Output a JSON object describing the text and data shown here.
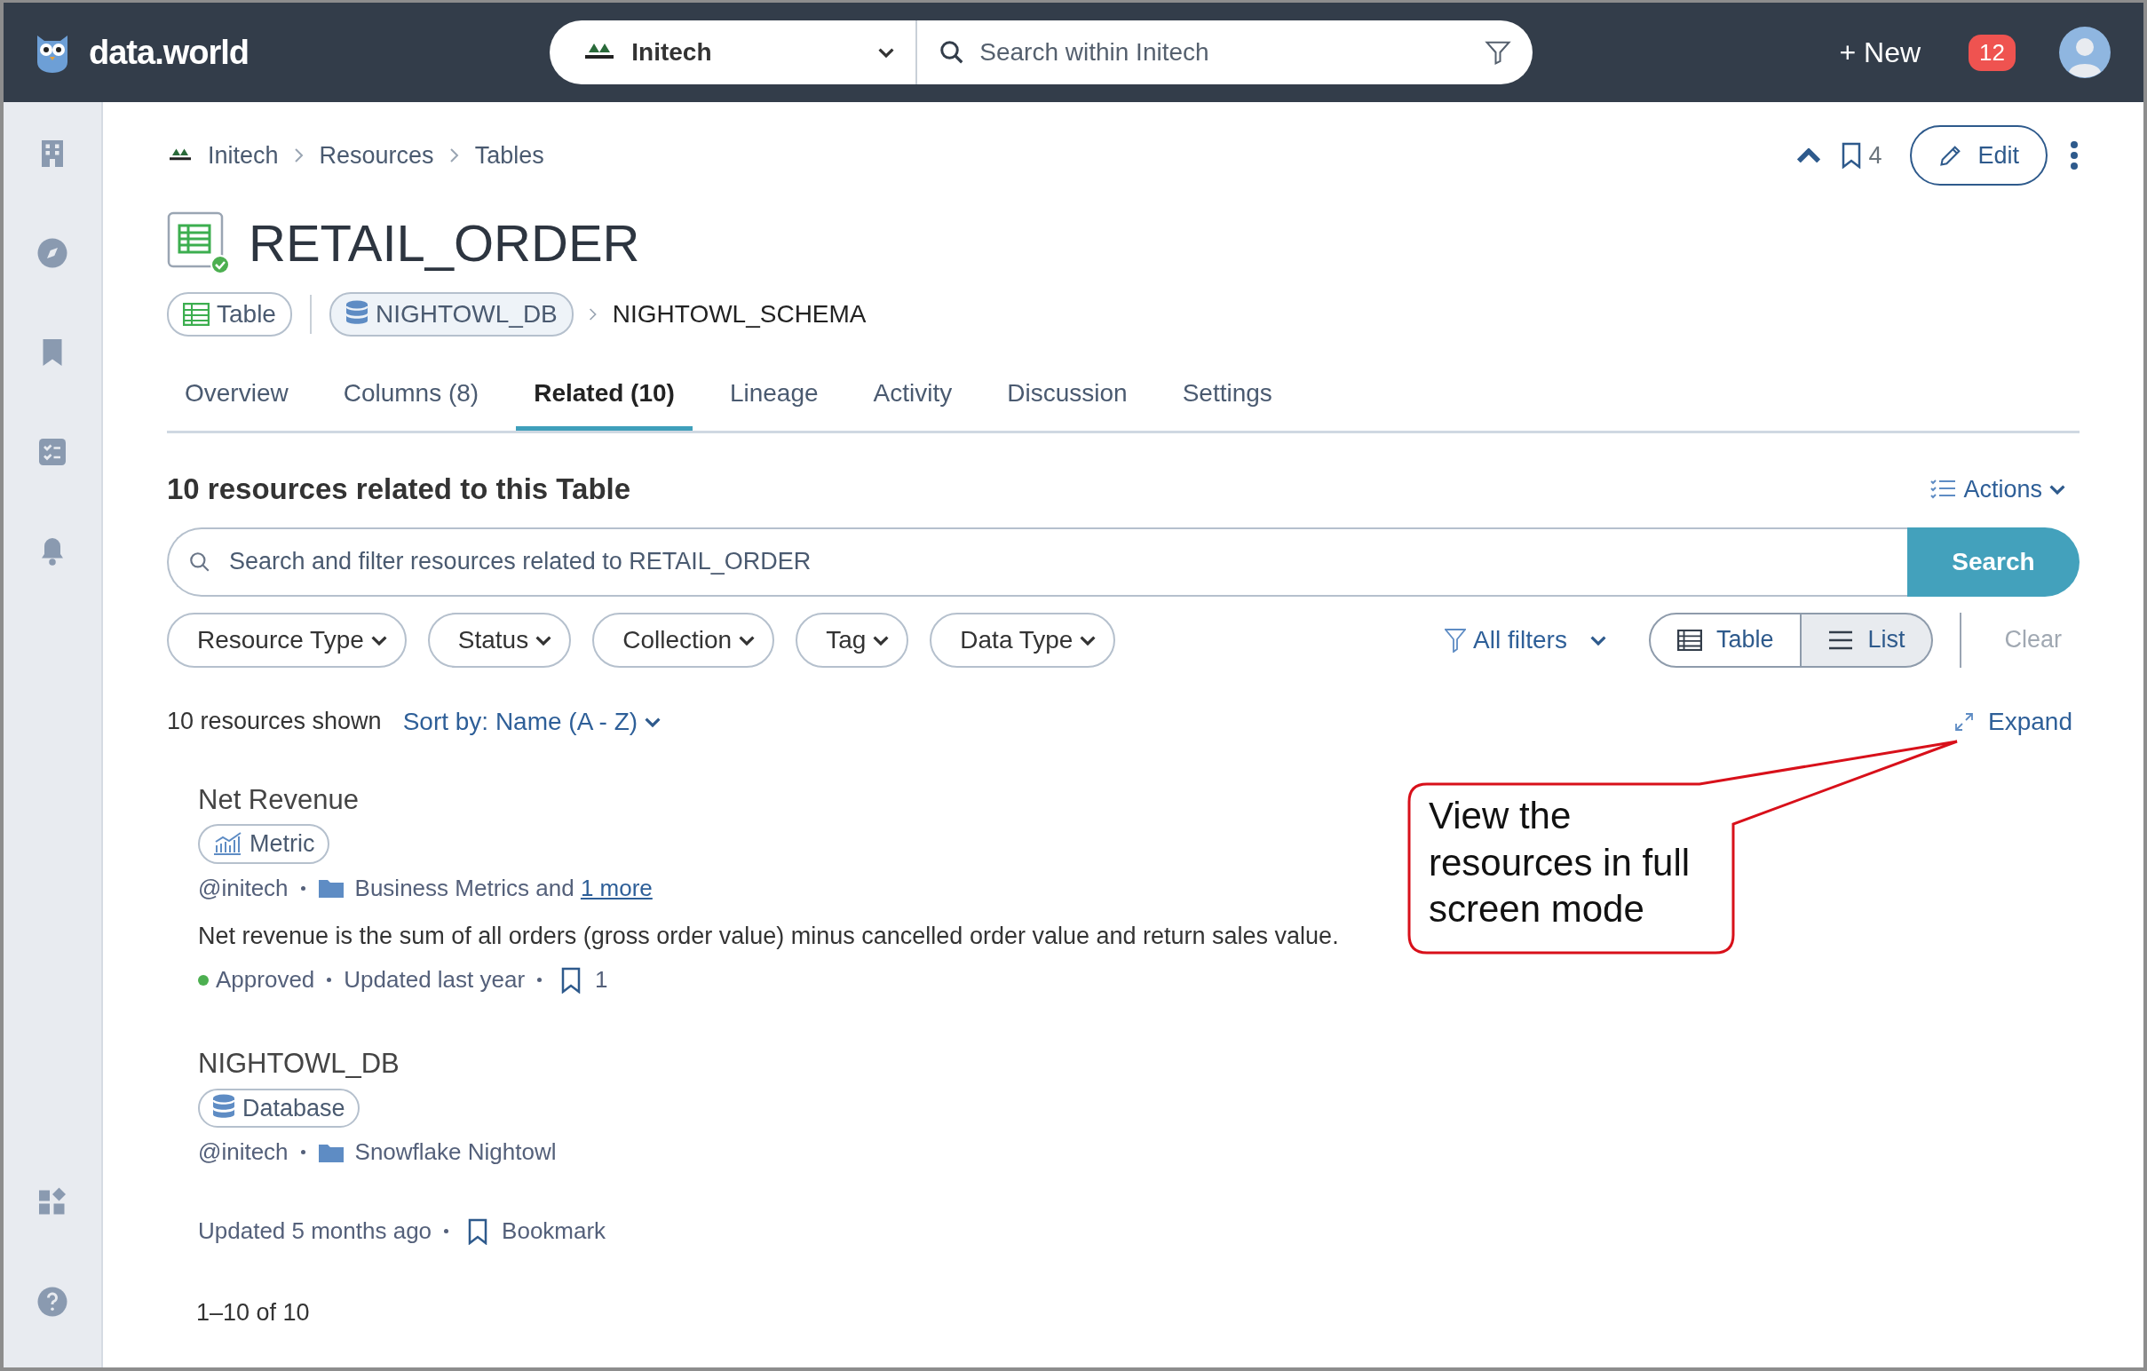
{
  "topbar": {
    "logo_text": "data.world",
    "org": "Initech",
    "search": {
      "placeholder": "Search within Initech"
    },
    "new_button": "+ New",
    "notification_count": "12"
  },
  "sidebar": {
    "items": [
      {
        "kind": "building"
      },
      {
        "kind": "compass"
      },
      {
        "kind": "bookmark"
      },
      {
        "kind": "checklist"
      },
      {
        "kind": "bell"
      },
      {
        "kind": "widgets"
      },
      {
        "kind": "help"
      }
    ]
  },
  "breadcrumb": [
    "Initech",
    "Resources",
    "Tables"
  ],
  "header": {
    "bookmark_count": "4",
    "edit_button": "Edit",
    "title": "RETAIL_ORDER",
    "type_badge": "Table",
    "database_badge": "NIGHTOWL_DB",
    "schema": "NIGHTOWL_SCHEMA"
  },
  "tabs": [
    {
      "label": "Overview",
      "selected": false
    },
    {
      "label": "Columns (8)",
      "selected": false
    },
    {
      "label": "Related (10)",
      "selected": true
    },
    {
      "label": "Lineage",
      "selected": false
    },
    {
      "label": "Activity",
      "selected": false
    },
    {
      "label": "Discussion",
      "selected": false
    },
    {
      "label": "Settings",
      "selected": false
    }
  ],
  "related": {
    "heading": "10 resources related to this Table",
    "actions_button": "Actions",
    "search": {
      "placeholder": "Search and filter resources related to RETAIL_ORDER"
    },
    "search_button": "Search",
    "filters": [
      "Resource Type",
      "Status",
      "Collection",
      "Tag",
      "Data Type"
    ],
    "all_filters": "All filters",
    "view_toggle": [
      {
        "kind": "table",
        "label": "Table",
        "selected": false
      },
      {
        "kind": "list",
        "label": "List",
        "selected": true
      }
    ],
    "clear_button": {
      "label": "Clear",
      "disabled": true
    },
    "shown_count": "10 resources shown",
    "sort": "Sort by: Name (A - Z)",
    "expand_link": "Expand"
  },
  "resources": [
    {
      "name": "Net Revenue",
      "type": {
        "kind": "metric",
        "label": "Metric"
      },
      "owner": "@initech",
      "collection": "Business Metrics",
      "more_prefix": "and",
      "more_link": "1 more",
      "description": "Net revenue is the sum of all orders (gross order value) minus cancelled order value and return sales value.",
      "status": {
        "label": "Approved",
        "color": "#4caf50"
      },
      "updated": "Updated last year",
      "bookmarks": "1"
    },
    {
      "name": "NIGHTOWL_DB",
      "type": {
        "kind": "database",
        "label": "Database"
      },
      "owner": "@initech",
      "collection": "Snowflake Nightowl",
      "updated": "Updated 5 months ago",
      "bookmark_label": "Bookmark"
    }
  ],
  "pagination": "1–10 of 10",
  "callout": {
    "text": "View the resources in full screen mode"
  }
}
